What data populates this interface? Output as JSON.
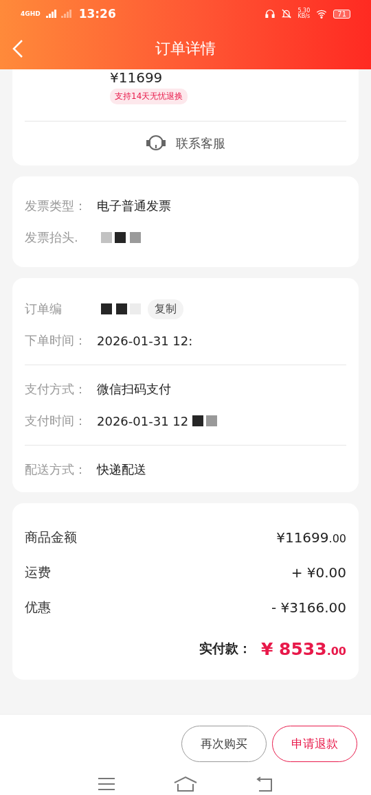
{
  "status_bar": {
    "network": "4GHD",
    "time": "13:26",
    "speed": "5.30",
    "speed_unit": "KB/s",
    "battery": "71"
  },
  "header": {
    "title": "订单详情"
  },
  "product": {
    "price": "¥11699",
    "tag": "支持14天无忧退换",
    "contact": "联系客服"
  },
  "invoice": [
    {
      "label": "发票类型：",
      "value": "电子普通发票",
      "redacted": false
    },
    {
      "label": "发票抬头.",
      "redacted": true
    }
  ],
  "order_info": [
    [
      {
        "label": "订单编",
        "redacted": true,
        "action": "复制"
      },
      {
        "label": "下单时间：",
        "value": "2026-01-31 12:",
        "redacted": false
      }
    ],
    [
      {
        "label": "支付方式：",
        "value": "微信扫码支付",
        "redacted": false
      },
      {
        "label": "支付时间：",
        "value": "2026-01-31 12",
        "redacted": true
      }
    ],
    [
      {
        "label": "配送方式：",
        "value": "快递配送",
        "redacted": false
      }
    ]
  ],
  "amounts": [
    {
      "label": "商品金额",
      "value": "¥11699",
      "cents": ".00"
    },
    {
      "label": "运费",
      "value": "+ ¥0.00"
    },
    {
      "label": "优惠",
      "value": "- ¥3166.00"
    }
  ],
  "total": {
    "label": "实付款：",
    "value": "¥ 8533",
    "cents": ".00"
  },
  "buttons": [
    {
      "label": "再次购买",
      "kind": "secondary"
    },
    {
      "label": "申请退款",
      "kind": "primary"
    }
  ]
}
